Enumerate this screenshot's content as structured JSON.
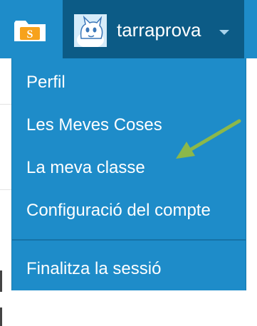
{
  "colors": {
    "menu_background": "#1e8cc9",
    "user_button_background": "#0c5b86",
    "text": "#ffffff",
    "annotation_arrow": "#8cb84a"
  },
  "header": {
    "folder_icon": "folder-s-icon",
    "folder_letter": "S",
    "avatar_icon": "scratch-cat-avatar",
    "username": "tarraprova",
    "dropdown_icon": "caret-down-icon"
  },
  "menu": {
    "items": [
      {
        "label": "Perfil"
      },
      {
        "label": "Les Meves Coses"
      },
      {
        "label": "La meva classe"
      },
      {
        "label": "Configuració del compte"
      }
    ],
    "logout_label": "Finalitza la sessió"
  },
  "annotation": {
    "icon": "pointer-arrow",
    "points_to": "La meva classe"
  }
}
